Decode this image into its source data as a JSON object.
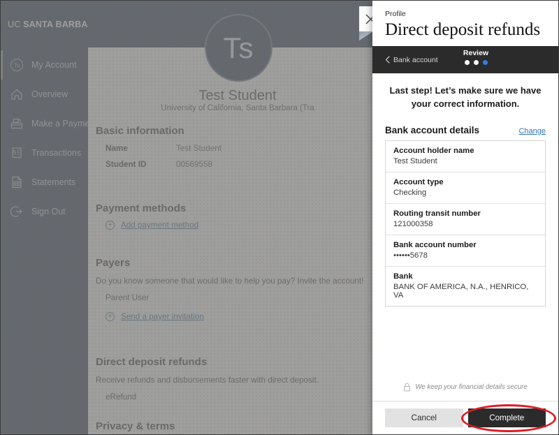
{
  "sidebar": {
    "logo": {
      "prefix": "UC ",
      "name": "SANTA BARBARA"
    },
    "items": [
      {
        "label": "My Account",
        "icon": "avatar-initials-icon"
      },
      {
        "label": "Overview",
        "icon": "home-icon"
      },
      {
        "label": "Make a Payment",
        "icon": "payment-card-icon"
      },
      {
        "label": "Transactions",
        "icon": "receipt-dollar-icon"
      },
      {
        "label": "Statements",
        "icon": "document-grid-icon"
      },
      {
        "label": "Sign Out",
        "icon": "sign-out-icon"
      }
    ]
  },
  "profile": {
    "avatar_initials": "Ts",
    "name": "Test Student",
    "organization": "University of California, Santa Barbara (Tra",
    "basic_information": {
      "title": "Basic information",
      "rows": [
        {
          "key": "Name",
          "value": "Test Student"
        },
        {
          "key": "Student ID",
          "value": "00569558"
        }
      ]
    },
    "payment_methods": {
      "title": "Payment methods",
      "add_link": "Add payment method"
    },
    "payers": {
      "title": "Payers",
      "description": "Do you know someone that would like to help you pay? Invite the account!",
      "entries": [
        "Parent User"
      ],
      "invite_link": "Send a payer invitation"
    },
    "direct_deposit": {
      "title": "Direct deposit refunds",
      "description": "Receive refunds and disbursements faster with direct deposit.",
      "entries": [
        "eRefund"
      ]
    },
    "privacy": {
      "title": "Privacy & terms"
    }
  },
  "panel": {
    "close_label": "close-icon",
    "breadcrumb": "Profile",
    "title": "Direct deposit refunds",
    "steps": {
      "back_label": "Bank account",
      "current_label": "Review",
      "total_dots": 3,
      "active_index": 2,
      "active_color": "#2f7fe8"
    },
    "lead": "Last step! Let’s make sure we have your correct information.",
    "details_heading": "Bank account details",
    "change_link": "Change",
    "details": [
      {
        "label": "Account holder name",
        "value": "Test Student"
      },
      {
        "label": "Account type",
        "value": "Checking"
      },
      {
        "label": "Routing transit number",
        "value": "121000358"
      },
      {
        "label": "Bank account number",
        "value": "••••••5678"
      },
      {
        "label": "Bank",
        "value": "BANK OF AMERICA, N.A., HENRICO, VA"
      }
    ],
    "secure_note": "We keep your financial details secure",
    "cancel_label": "Cancel",
    "complete_label": "Complete"
  },
  "theme": {
    "navy": "#0d2240",
    "panel_dark": "#2b2b2b",
    "accent_blue": "#2f7fe8",
    "link_blue": "#1f5b82",
    "annotation_red": "#e01b24"
  }
}
